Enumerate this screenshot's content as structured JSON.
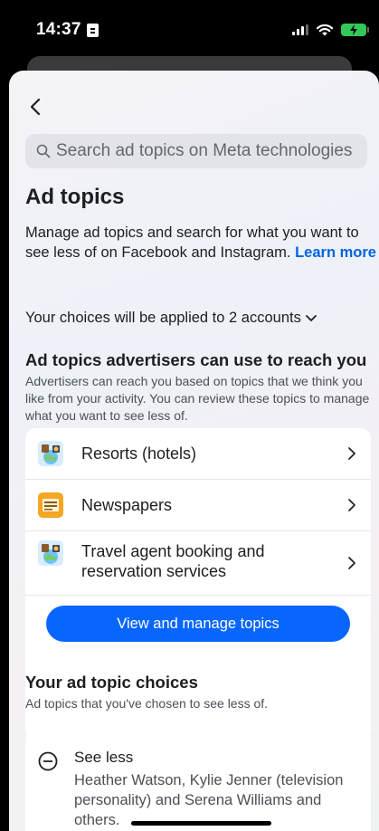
{
  "status_bar": {
    "time": "14:37"
  },
  "search": {
    "placeholder": "Search ad topics on Meta technologies"
  },
  "header": {
    "title": "Ad topics",
    "intro_text": "Manage ad topics and search for what you want to see less of on Facebook and Instagram. ",
    "learn_more": "Learn more",
    "accounts_text": "Your choices will be applied to 2 accounts"
  },
  "advertiser_section": {
    "title": "Ad topics advertisers can use to reach you",
    "description": "Advertisers can reach you based on topics that we think you like from your activity. You can review these topics to manage what you want to see less of.",
    "topics": [
      {
        "label": "Resorts (hotels)",
        "icon": "travel-icon"
      },
      {
        "label": "Newspapers",
        "icon": "newspaper-icon"
      },
      {
        "label": "Travel agent booking and reservation services",
        "icon": "travel-icon"
      }
    ],
    "button_label": "View and manage topics"
  },
  "choices_section": {
    "title": "Your ad topic choices",
    "description": "Ad topics that you've chosen to see less of.",
    "item_title": "See less",
    "item_description": "Heather Watson, Kylie Jenner (television personality) and Serena Williams and others."
  },
  "colors": {
    "accent": "#0866ff",
    "link": "#0064e0",
    "battery": "#34c759"
  }
}
